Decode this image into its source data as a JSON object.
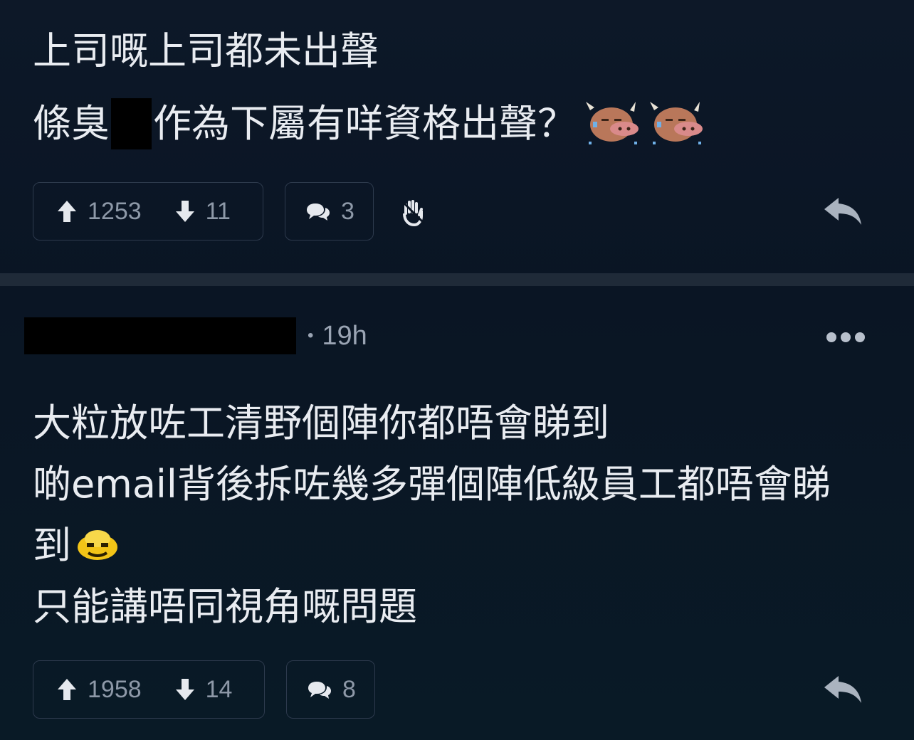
{
  "comment1": {
    "line1": "上司嘅上司都未出聲",
    "line2_before": "條臭",
    "line2_after": "作為下屬有咩資格出聲？",
    "emoji_name": "ox-sweat-icon",
    "upvotes": "1253",
    "downvotes": "11",
    "replies": "3"
  },
  "comment2": {
    "meta_separator": "•",
    "time": "19h",
    "lines": [
      "大粒放咗工清野個陣你都唔會睇到",
      "啲email背後拆咗幾多彈個陣低級員工都唔會睇",
      "到",
      "只能講唔同視角嘅問題"
    ],
    "emoji_name": "yellow-face-icon",
    "upvotes": "1958",
    "downvotes": "14",
    "replies": "8"
  },
  "colors": {
    "background": "#0b1523",
    "divider": "#1f2a38",
    "text": "#e9ecf1",
    "muted": "#8e99a8",
    "border": "#2d3a4d"
  }
}
